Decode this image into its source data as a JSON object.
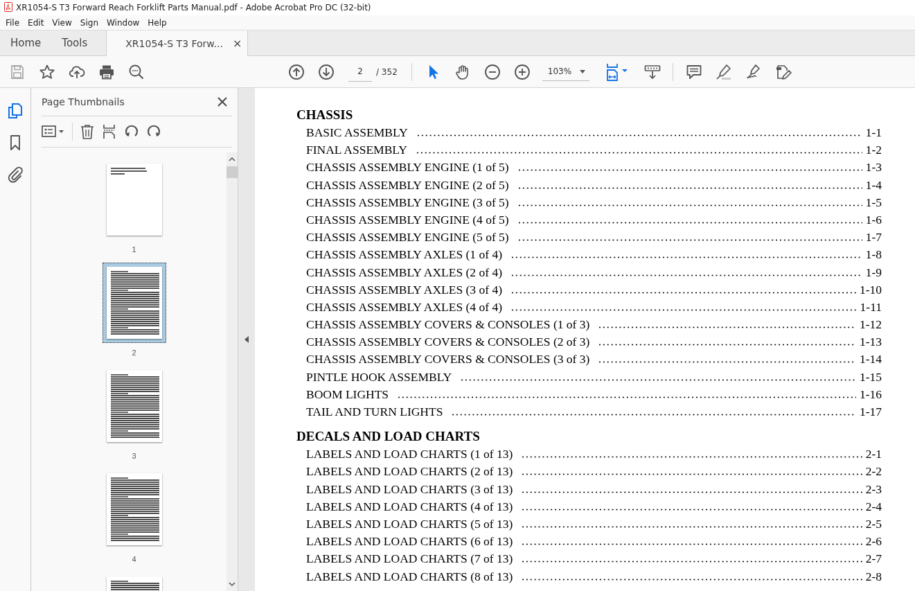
{
  "window": {
    "title": "XR1054-S T3 Forward Reach Forklift Parts Manual.pdf - Adobe Acrobat Pro DC (32-bit)"
  },
  "menu": [
    "File",
    "Edit",
    "View",
    "Sign",
    "Window",
    "Help"
  ],
  "tabs": [
    {
      "label": "Home",
      "selected": false
    },
    {
      "label": "Tools",
      "selected": false
    },
    {
      "label": "XR1054-S T3 Forw...",
      "selected": true,
      "close": "×"
    }
  ],
  "toolbar": {
    "page": "2",
    "page_total": "/ 352",
    "zoom": "103%"
  },
  "side_rail": [
    {
      "kind": "pages",
      "selected": true
    },
    {
      "kind": "bookmarks",
      "selected": false
    },
    {
      "kind": "attachments",
      "selected": false
    }
  ],
  "panel": {
    "title": "Page Thumbnails"
  },
  "thumbnails": [
    {
      "kind": "title",
      "label": "1",
      "selected": false
    },
    {
      "kind": "toc",
      "label": "2",
      "selected": true
    },
    {
      "kind": "toc",
      "label": "3",
      "selected": false
    },
    {
      "kind": "toc",
      "label": "4",
      "selected": false
    },
    {
      "kind": "toc",
      "selected": false
    }
  ],
  "document": {
    "sections": [
      {
        "heading": "CHASSIS",
        "entries": [
          {
            "title": "BASIC ASSEMBLY",
            "page": "1-1"
          },
          {
            "title": "FINAL ASSEMBLY",
            "page": "1-2"
          },
          {
            "title": "CHASSIS ASSEMBLY ENGINE (1 of 5)",
            "page": "1-3"
          },
          {
            "title": "CHASSIS ASSEMBLY ENGINE (2 of 5)",
            "page": "1-4"
          },
          {
            "title": "CHASSIS ASSEMBLY ENGINE (3 of 5)",
            "page": "1-5"
          },
          {
            "title": "CHASSIS ASSEMBLY ENGINE (4 of 5)",
            "page": "1-6"
          },
          {
            "title": "CHASSIS ASSEMBLY ENGINE (5 of 5)",
            "page": "1-7"
          },
          {
            "title": "CHASSIS ASSEMBLY AXLES (1 of 4)",
            "page": "1-8"
          },
          {
            "title": "CHASSIS ASSEMBLY AXLES (2 of 4)",
            "page": "1-9"
          },
          {
            "title": "CHASSIS ASSEMBLY AXLES (3 of 4)",
            "page": "1-10"
          },
          {
            "title": "CHASSIS ASSEMBLY AXLES (4 of 4)",
            "page": "1-11"
          },
          {
            "title": "CHASSIS ASSEMBLY COVERS & CONSOLES (1 of 3)",
            "page": "1-12"
          },
          {
            "title": "CHASSIS ASSEMBLY COVERS & CONSOLES (2 of 3)",
            "page": "1-13"
          },
          {
            "title": "CHASSIS ASSEMBLY COVERS & CONSOLES (3 of 3)",
            "page": "1-14"
          },
          {
            "title": "PINTLE HOOK ASSEMBLY",
            "page": "1-15"
          },
          {
            "title": "BOOM LIGHTS",
            "page": "1-16"
          },
          {
            "title": "TAIL AND TURN LIGHTS",
            "page": "1-17"
          }
        ]
      },
      {
        "heading": "DECALS AND LOAD CHARTS",
        "entries": [
          {
            "title": "LABELS AND LOAD CHARTS (1 of 13)",
            "page": "2-1"
          },
          {
            "title": "LABELS AND LOAD CHARTS (2 of 13)",
            "page": "2-2"
          },
          {
            "title": "LABELS AND LOAD CHARTS (3 of 13)",
            "page": "2-3"
          },
          {
            "title": "LABELS AND LOAD CHARTS (4 of 13)",
            "page": "2-4"
          },
          {
            "title": "LABELS AND LOAD CHARTS (5 of 13)",
            "page": "2-5"
          },
          {
            "title": "LABELS AND LOAD CHARTS (6 of 13)",
            "page": "2-6"
          },
          {
            "title": "LABELS AND LOAD CHARTS (7 of 13)",
            "page": "2-7"
          },
          {
            "title": "LABELS AND LOAD CHARTS (8 of 13)",
            "page": "2-8"
          }
        ]
      }
    ]
  }
}
